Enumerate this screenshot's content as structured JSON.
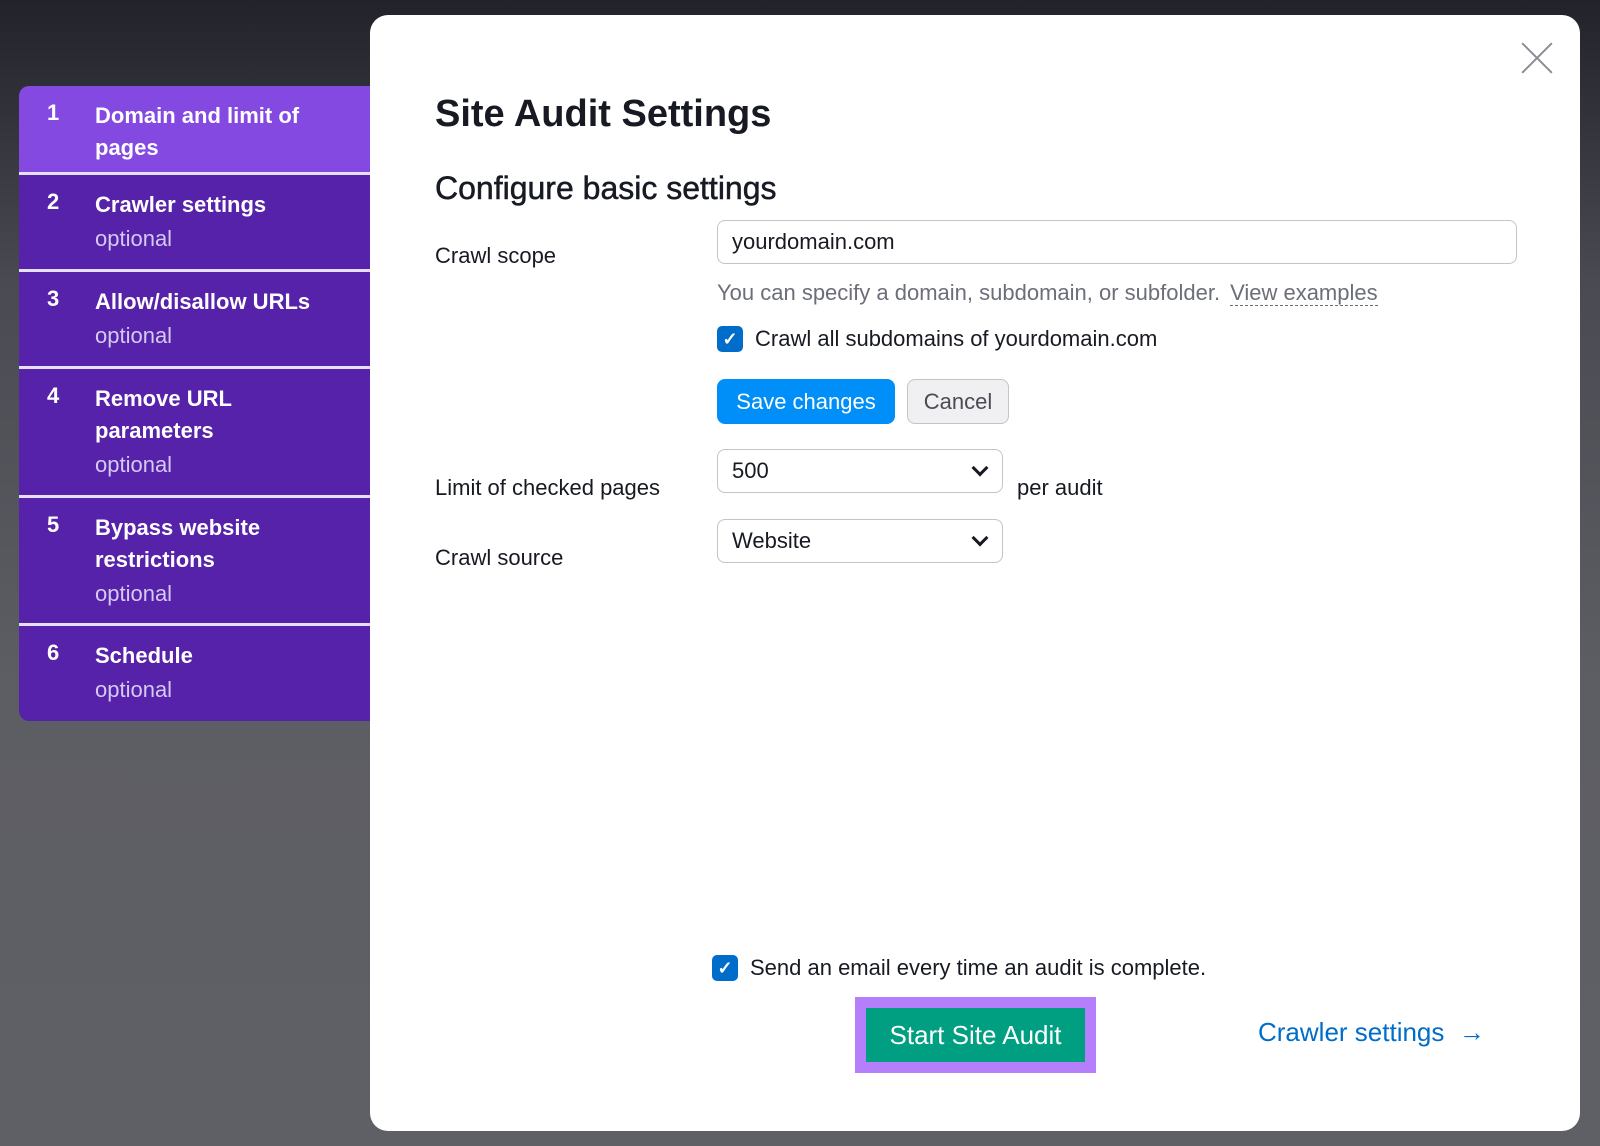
{
  "sidebar": {
    "steps": [
      {
        "num": "1",
        "title": "Domain and limit of pages",
        "sub": ""
      },
      {
        "num": "2",
        "title": "Crawler settings",
        "sub": "optional"
      },
      {
        "num": "3",
        "title": "Allow/disallow URLs",
        "sub": "optional"
      },
      {
        "num": "4",
        "title": "Remove URL parameters",
        "sub": "optional"
      },
      {
        "num": "5",
        "title": "Bypass website restrictions",
        "sub": "optional"
      },
      {
        "num": "6",
        "title": "Schedule",
        "sub": "optional"
      }
    ]
  },
  "modal": {
    "title": "Site Audit Settings",
    "subtitle": "Configure basic settings",
    "crawl_scope": {
      "label": "Crawl scope",
      "value": "yourdomain.com",
      "hint": "You can specify a domain, subdomain, or subfolder.",
      "hint_link": "View examples",
      "checkbox": "Crawl all subdomains of yourdomain.com",
      "checked": true
    },
    "save": "Save changes",
    "cancel": "Cancel",
    "limit": {
      "label": "Limit of checked pages",
      "value": "500",
      "suffix": "per audit"
    },
    "source": {
      "label": "Crawl source",
      "value": "Website"
    },
    "email": {
      "label": "Send an email every time an audit is complete.",
      "checked": true
    },
    "start": "Start Site Audit",
    "crawler_link": "Crawler settings",
    "arrow": "→",
    "check": "✓"
  },
  "colors": {
    "active_step": "#8349e0",
    "step": "#5522a9",
    "primary": "#008ff8",
    "start": "#009f81",
    "highlight": "#b57ffb",
    "link": "#006dca"
  }
}
